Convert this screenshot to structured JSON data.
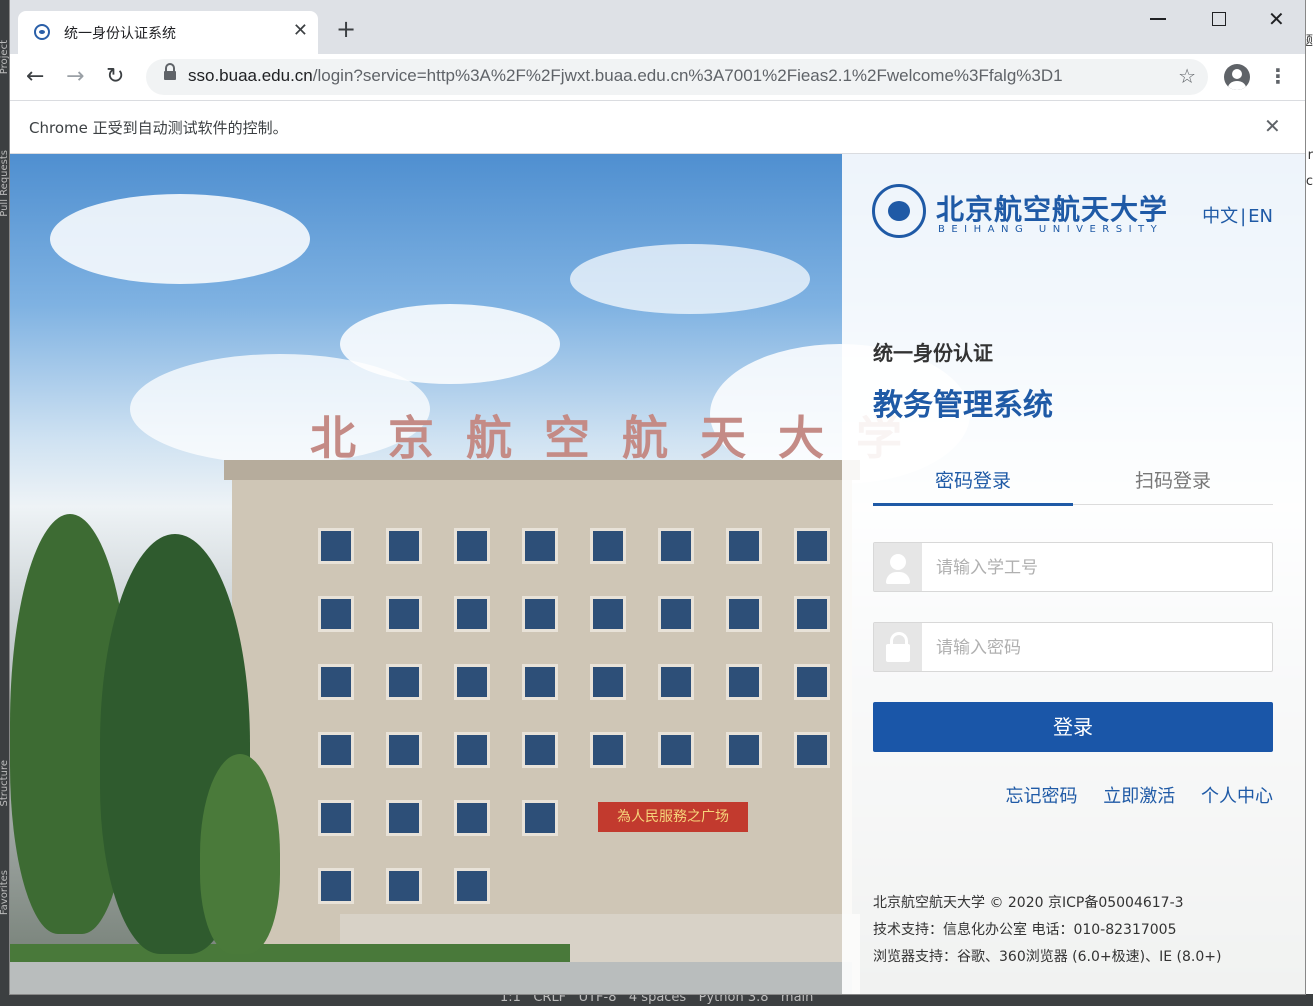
{
  "ide": {
    "left_labels": [
      "Project",
      "Pull Requests",
      "Structure",
      "Favorites"
    ],
    "status_items": [
      "1:1",
      "CRLF",
      "UTF-8",
      "4 spaces",
      "Python 3.8",
      "main"
    ],
    "right_fragments": [
      "题",
      "r",
      "c"
    ]
  },
  "browser": {
    "tab_title": "统一身份认证系统",
    "url_host": "sso.buaa.edu.cn",
    "url_rest": "/login?service=http%3A%2F%2Fjwxt.buaa.edu.cn%3A7001%2Fieas2.1%2Fwelcome%3Ffalg%3D1",
    "infobar_message": "Chrome 正受到自动测试软件的控制。"
  },
  "photo": {
    "rooftop_sign": "北京航空航天大学",
    "banner": "為人民服務之广场"
  },
  "login": {
    "logo_cn": "北京航空航天大学",
    "logo_en": "BEIHANG UNIVERSITY",
    "lang_cn": "中文",
    "lang_sep": "|",
    "lang_en": "EN",
    "subtitle": "统一身份认证",
    "system_name": "教务管理系统",
    "tab_password": "密码登录",
    "tab_qr": "扫码登录",
    "username_placeholder": "请输入学工号",
    "password_placeholder": "请输入密码",
    "login_button": "登录",
    "link_forgot": "忘记密码",
    "link_activate": "立即激活",
    "link_personal": "个人中心",
    "footer_line1": "北京航空航天大学 © 2020 京ICP备05004617-3",
    "footer_line2": "技术支持：信息化办公室 电话：010-82317005",
    "footer_line3": "浏览器支持：谷歌、360浏览器 (6.0+极速)、IE (8.0+)"
  },
  "colors": {
    "brand_blue": "#1a56a8",
    "link_blue": "#1f5aa6"
  }
}
